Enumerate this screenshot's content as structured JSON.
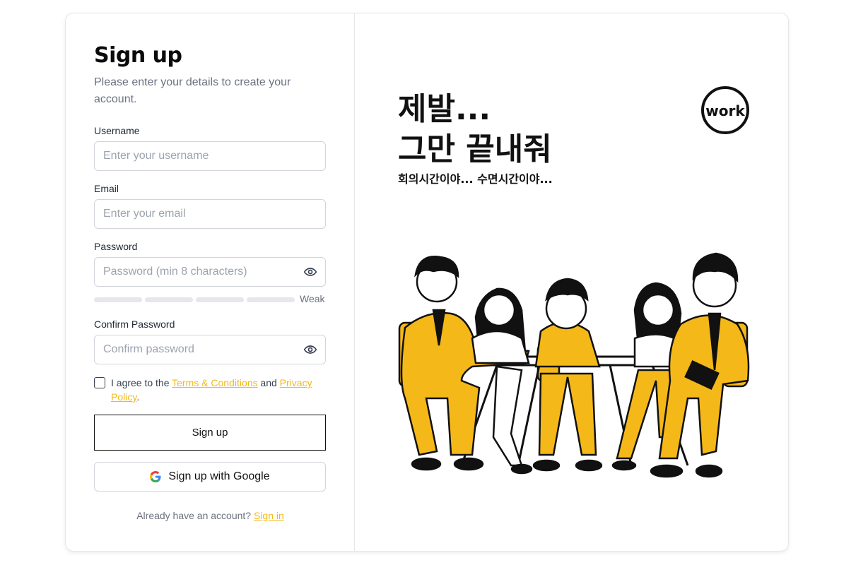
{
  "form": {
    "title": "Sign up",
    "subtitle": "Please enter your details to create your account.",
    "username_label": "Username",
    "username_placeholder": "Enter your username",
    "email_label": "Email",
    "email_placeholder": "Enter your email",
    "password_label": "Password",
    "password_placeholder": "Password (min 8 characters)",
    "strength_text": "Weak",
    "strength_level": 0,
    "confirm_label": "Confirm Password",
    "confirm_placeholder": "Confirm password",
    "agree_prefix": "I agree to the ",
    "terms_link": "Terms & Conditions",
    "agree_and": " and ",
    "privacy_link": "Privacy Policy",
    "agree_suffix": ".",
    "signup_button": "Sign up",
    "google_button": "Sign up with Google",
    "already_text": "Already have an account? ",
    "signin_link": "Sign in"
  },
  "poster": {
    "line1": "제발...",
    "line2": "그만 끝내줘",
    "line3": "회의시간이야... 수면시간이야...",
    "badge": "work",
    "accent": "#f5b819"
  }
}
